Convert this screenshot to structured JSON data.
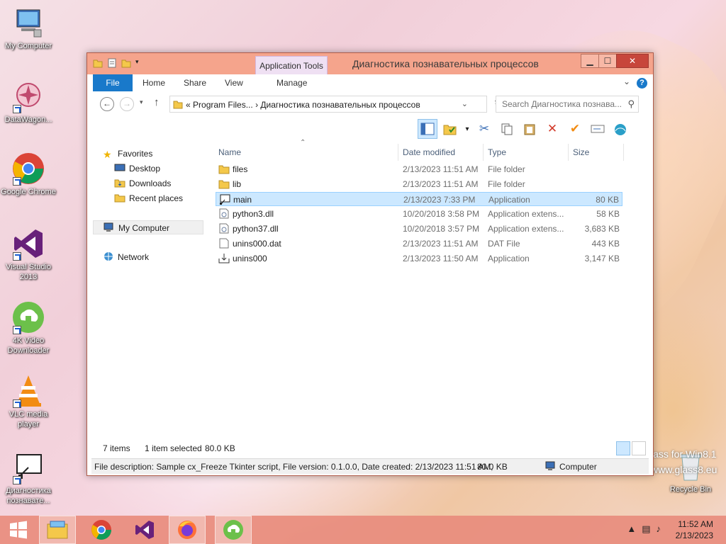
{
  "desktop": {
    "icons": [
      {
        "label": "My Computer"
      },
      {
        "label": "DataWagon..."
      },
      {
        "label": "Google Chrome"
      },
      {
        "label": "Visual Studio 2013"
      },
      {
        "label": "4K Video Downloader"
      },
      {
        "label": "VLC media player"
      },
      {
        "label": "Диагностика познавате..."
      },
      {
        "label": "Recycle Bin"
      }
    ],
    "watermark_line1": "lass for Win8.1",
    "watermark_line2": "www.glass8.eu"
  },
  "window": {
    "title": "Диагностика познавательных процессов",
    "context_tab": "Application Tools",
    "buttons": {
      "minimize": "▁",
      "maximize": "☐",
      "close": "✕"
    },
    "ribbon_tabs": [
      "File",
      "Home",
      "Share",
      "View",
      "Manage"
    ],
    "help": "?",
    "address": {
      "prefix": "«",
      "crumb1": "Program Files...",
      "sep": "›",
      "crumb2": "Диагностика познавательных процессов"
    },
    "search_placeholder": "Search Диагностика познава..."
  },
  "nav_pane": {
    "favorites": "Favorites",
    "desktop": "Desktop",
    "downloads": "Downloads",
    "recent": "Recent places",
    "computer": "My Computer",
    "network": "Network"
  },
  "columns": {
    "name": "Name",
    "date": "Date modified",
    "type": "Type",
    "size": "Size"
  },
  "files": [
    {
      "name": "files",
      "date": "2/13/2023 11:51 AM",
      "type": "File folder",
      "size": "",
      "icon": "folder-icon"
    },
    {
      "name": "lib",
      "date": "2/13/2023 11:51 AM",
      "type": "File folder",
      "size": "",
      "icon": "folder-icon"
    },
    {
      "name": "main",
      "date": "2/13/2023 7:33 PM",
      "type": "Application",
      "size": "80 KB",
      "icon": "application-icon"
    },
    {
      "name": "python3.dll",
      "date": "10/20/2018 3:58 PM",
      "type": "Application extens...",
      "size": "58 KB",
      "icon": "dll-icon"
    },
    {
      "name": "python37.dll",
      "date": "10/20/2018 3:57 PM",
      "type": "Application extens...",
      "size": "3,683 KB",
      "icon": "dll-icon"
    },
    {
      "name": "unins000.dat",
      "date": "2/13/2023 11:51 AM",
      "type": "DAT File",
      "size": "443 KB",
      "icon": "file-icon"
    },
    {
      "name": "unins000",
      "date": "2/13/2023 11:50 AM",
      "type": "Application",
      "size": "3,147 KB",
      "icon": "uninstall-icon"
    }
  ],
  "status": {
    "count": "7 items",
    "selected": "1 item selected",
    "sel_size": "80.0 KB"
  },
  "description": {
    "text": "File description: Sample cx_Freeze Tkinter script, File version: 0.1.0.0, Date created: 2/13/2023 11:51 AM,",
    "size": "80.0 KB",
    "location": "Computer"
  },
  "taskbar": {
    "time": "11:52 AM",
    "date": "2/13/2023"
  },
  "colors": {
    "titlebar": "#f5a48c",
    "file_tab": "#1979ca",
    "selection": "#cce8ff",
    "taskbar": "#e88c7d"
  }
}
